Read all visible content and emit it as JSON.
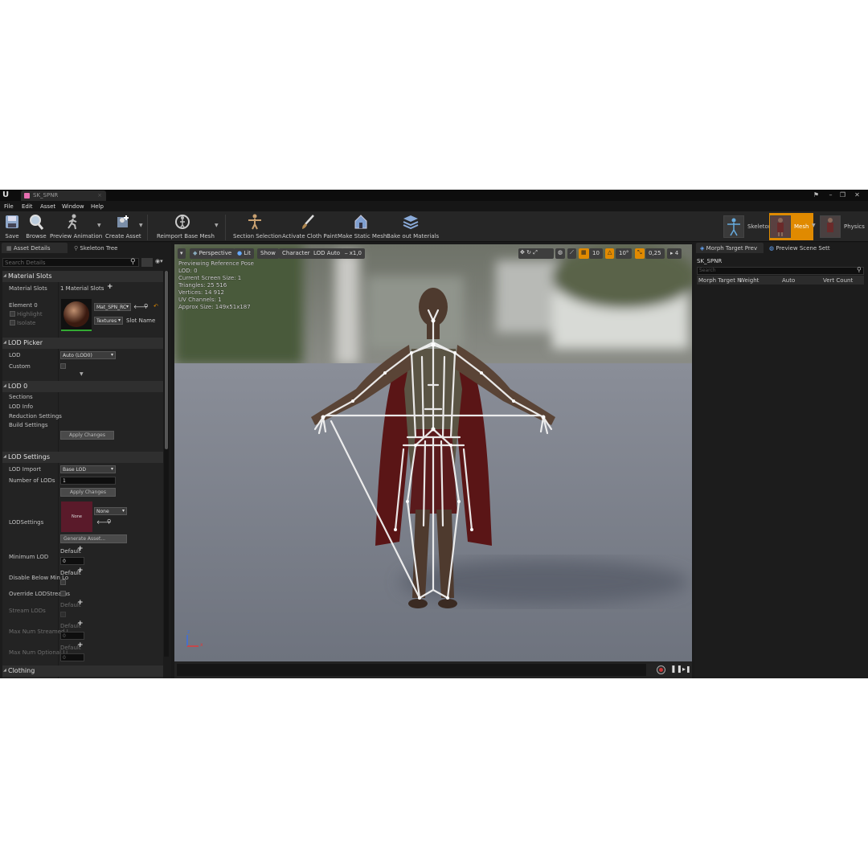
{
  "app": {
    "tab_title": "SK_SPNR"
  },
  "menu": [
    "File",
    "Edit",
    "Asset",
    "Window",
    "Help"
  ],
  "toolbar": {
    "save": "Save",
    "browse": "Browse",
    "preview_animation": "Preview Animation",
    "create_asset": "Create Asset",
    "reimport": "Reimport Base Mesh",
    "section_selection": "Section Selection",
    "cloth_paint": "Activate Cloth Paint",
    "make_static": "Make Static Mesh",
    "bake_materials": "Bake out Materials"
  },
  "modes": {
    "skeleton": "Skeleton",
    "mesh": "Mesh",
    "physics": "Physics"
  },
  "left_panel": {
    "tabs": [
      "Asset Details",
      "Skeleton Tree"
    ],
    "search_placeholder": "Search Details",
    "material_slots": {
      "header": "Material Slots",
      "label": "Material Slots",
      "count": "1 Material Slots",
      "element": "Element 0",
      "highlight": "Highlight",
      "isolate": "Isolate",
      "material_value": "Mat_SPN_RC",
      "textures": "Textures",
      "slot_name": "Slot Name"
    },
    "lod_picker": {
      "header": "LOD Picker",
      "lod_label": "LOD",
      "lod_value": "Auto (LOD0)",
      "custom_label": "Custom"
    },
    "lod0": {
      "header": "LOD 0",
      "items": [
        "Sections",
        "LOD Info",
        "Reduction Settings",
        "Build Settings"
      ],
      "apply": "Apply Changes"
    },
    "lod_settings": {
      "header": "LOD Settings",
      "lod_import_label": "LOD Import",
      "lod_import_value": "Base LOD",
      "num_lods_label": "Number of LODs",
      "num_lods_value": "1",
      "apply": "Apply Changes",
      "lodsettings_label": "LODSettings",
      "thumb_text": "None",
      "combo_value": "None",
      "generate": "Generate Asset...",
      "min_lod_label": "Minimum LOD",
      "min_lod_default": "Default",
      "min_lod_value": "0",
      "disable_below_label": "Disable Below Min Lo",
      "disable_below_default": "Default",
      "override_label": "Override LODStreams",
      "stream_lods_label": "Stream LODs",
      "stream_default": "Default",
      "max_stream_label": "Max Num Streamed L",
      "max_stream_default": "Default",
      "max_stream_value": "0",
      "max_optional_label": "Max Num Optional Li",
      "max_optional_default": "Default",
      "max_optional_value": "0"
    },
    "clothing": {
      "header": "Clothing"
    }
  },
  "viewport": {
    "perspective": "Perspective",
    "lit": "Lit",
    "show": "Show",
    "character": "Character",
    "lod": "LOD Auto",
    "speed": "x1,0",
    "grid": "10",
    "angle": "10°",
    "scale": "0,25",
    "cam": "4",
    "stats": [
      "Previewing Reference Pose",
      "LOD: 0",
      "Current Screen Size: 1",
      "Triangles: 25 516",
      "Vertices: 14 912",
      "UV Channels: 1",
      "Approx Size: 149x51x187"
    ],
    "axis_x": "x",
    "axis_z": "z"
  },
  "right_panel": {
    "tabs": [
      "Morph Target Prev",
      "Preview Scene Sett"
    ],
    "asset": "SK_SPNR",
    "search_placeholder": "Search",
    "columns": [
      "Morph Target N",
      "Weight",
      "Auto",
      "Vert Count"
    ]
  },
  "colors": {
    "accent": "#e08a00",
    "bg": "#1c1c1c",
    "toolbar": "#262626"
  }
}
